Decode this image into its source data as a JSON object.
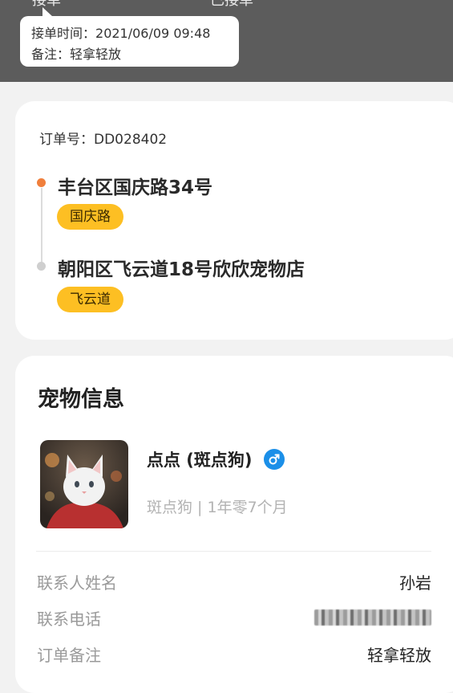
{
  "header": {
    "partial_left": "接单",
    "partial_center": "已接单"
  },
  "tooltip": {
    "time_label": "接单时间：",
    "time_value": "2021/06/09 09:48",
    "note_label": "备注：",
    "note_value": "轻拿轻放"
  },
  "order": {
    "number_label": "订单号：",
    "number": "DD028402",
    "pickup_address": "丰台区国庆路34号",
    "pickup_tag": "国庆路",
    "dropoff_address": "朝阳区飞云道18号欣欣宠物店",
    "dropoff_tag": "飞云道",
    "colors": {
      "start_dot": "#f07f3c",
      "end_dot": "#cfcfcf",
      "tag_bg": "#fdbf23"
    }
  },
  "pet": {
    "section_title": "宠物信息",
    "name": "点点 (斑点狗)",
    "gender_icon": "male-icon",
    "gender_color": "#1b8fe8",
    "subtitle": "斑点狗 | 1年零7个月"
  },
  "details": [
    {
      "label": "联系人姓名",
      "value": "孙岩"
    },
    {
      "label": "联系电话",
      "value": ""
    },
    {
      "label": "订单备注",
      "value": "轻拿轻放"
    }
  ]
}
